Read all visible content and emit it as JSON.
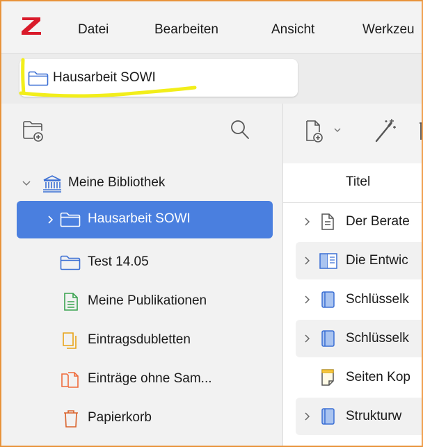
{
  "app": {
    "logo_letter": "Z"
  },
  "menu": {
    "items": [
      "Datei",
      "Bearbeiten",
      "Ansicht",
      "Werkzeu"
    ]
  },
  "tab": {
    "label": "Hausarbeit SOWI"
  },
  "sidebar": {
    "items": [
      {
        "label": "Meine Bibliothek",
        "icon": "library-icon"
      },
      {
        "label": "Hausarbeit SOWI",
        "icon": "folder-icon",
        "selected": true
      },
      {
        "label": "Test 14.05",
        "icon": "folder-icon"
      },
      {
        "label": "Meine Publikationen",
        "icon": "publications-icon"
      },
      {
        "label": "Eintragsdubletten",
        "icon": "duplicates-icon"
      },
      {
        "label": "Einträge ohne Sam...",
        "icon": "unfiled-icon"
      },
      {
        "label": "Papierkorb",
        "icon": "trash-icon"
      }
    ]
  },
  "items": {
    "column_title": "Titel",
    "rows": [
      {
        "label": "Der Berate",
        "icon": "document-icon"
      },
      {
        "label": "Die Entwic",
        "icon": "book-section-icon"
      },
      {
        "label": "Schlüsselk",
        "icon": "book-icon"
      },
      {
        "label": "Schlüsselk",
        "icon": "book-icon"
      },
      {
        "label": "Seiten Kop",
        "icon": "note-icon"
      },
      {
        "label": "Strukturw",
        "icon": "book-icon"
      }
    ]
  },
  "colors": {
    "accent": "#4a7fdf",
    "logo": "#d91a2a",
    "highlight": "#f2ee1a",
    "frame": "#e8933a",
    "folder": "#3b6fd4",
    "publications": "#3aa350",
    "duplicates": "#e8a317",
    "unfiled": "#ef6b3b",
    "trash": "#d9622b"
  }
}
